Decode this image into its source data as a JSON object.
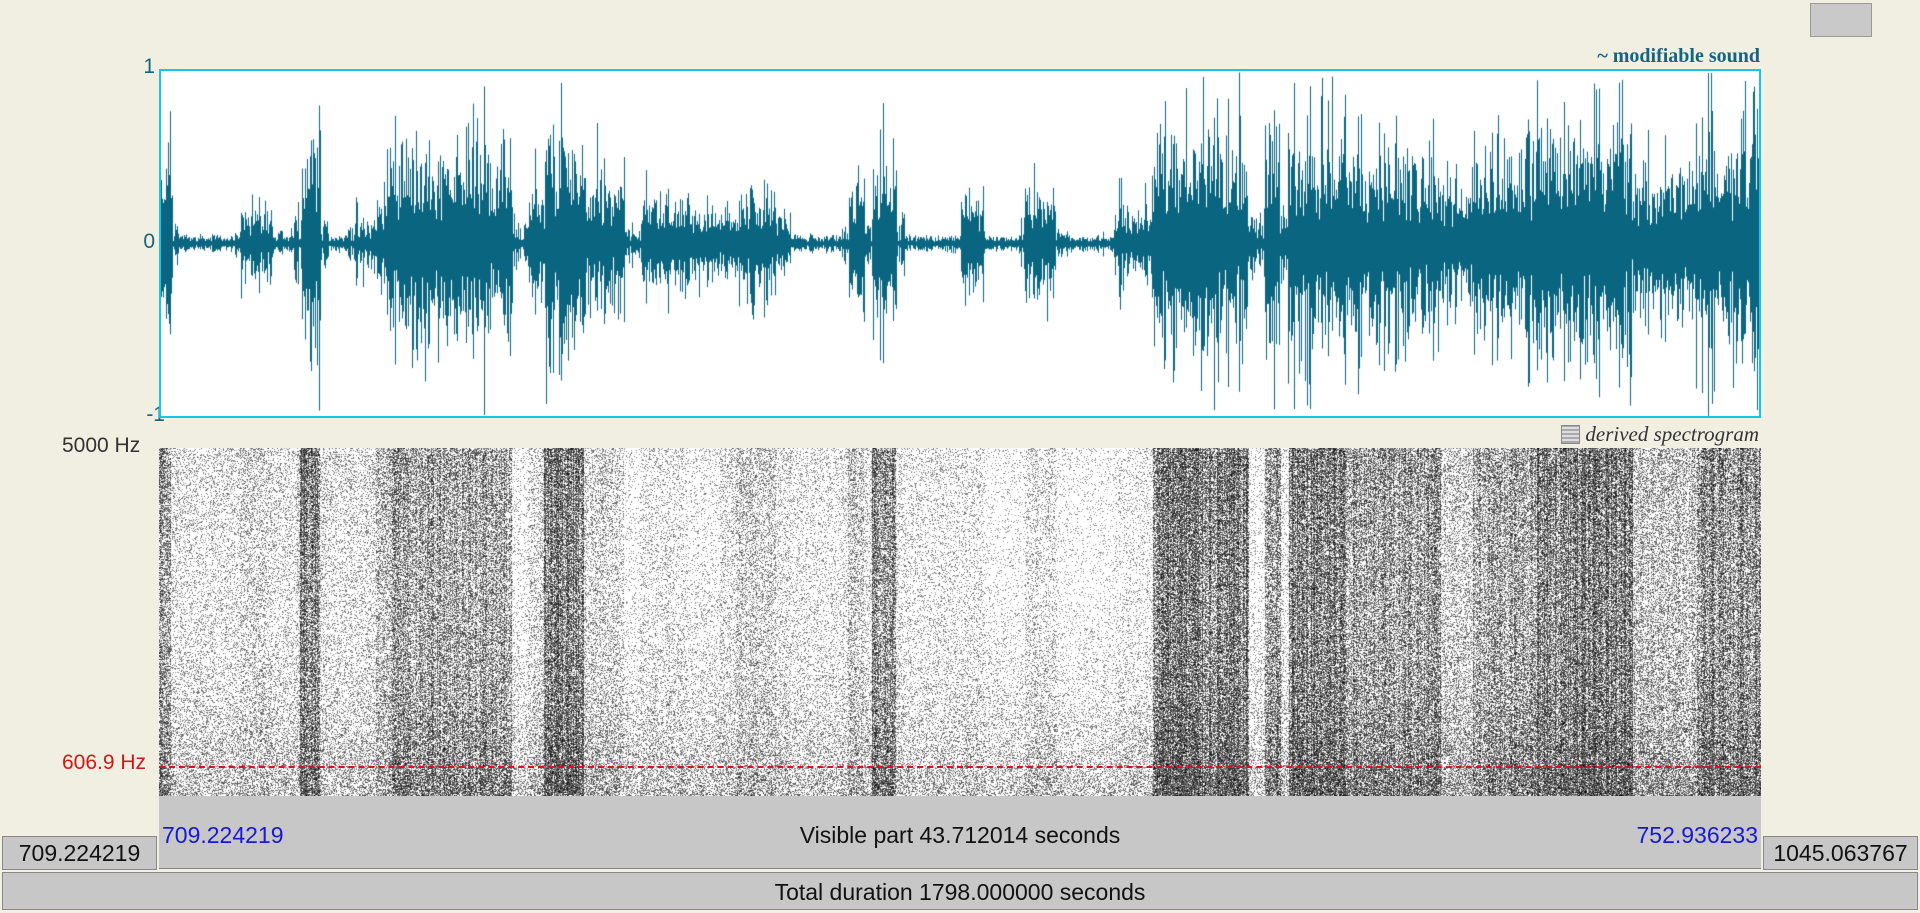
{
  "waveform": {
    "label": "~ modifiable sound",
    "y_ticks": {
      "top": "1",
      "middle": "0",
      "bottom": "-1"
    },
    "color": "#0a6680",
    "border_color": "#18c3ec"
  },
  "spectrogram": {
    "label": "derived spectrogram",
    "max_freq_label": "5000 Hz",
    "cursor_freq_label": "606.9 Hz",
    "cursor_freq_value_hz": 606.9,
    "max_freq_hz": 5000,
    "cursor_color": "#d01818"
  },
  "time": {
    "window_start": "709.224219",
    "window_end": "1045.063767",
    "visible_start": "709.224219",
    "visible_end": "752.936233",
    "visible_part_label": "Visible part 43.712014 seconds",
    "total_duration_label": "Total duration 1798.000000 seconds"
  },
  "icons": {
    "spectrogram_icon": "spectrogram-icon"
  }
}
